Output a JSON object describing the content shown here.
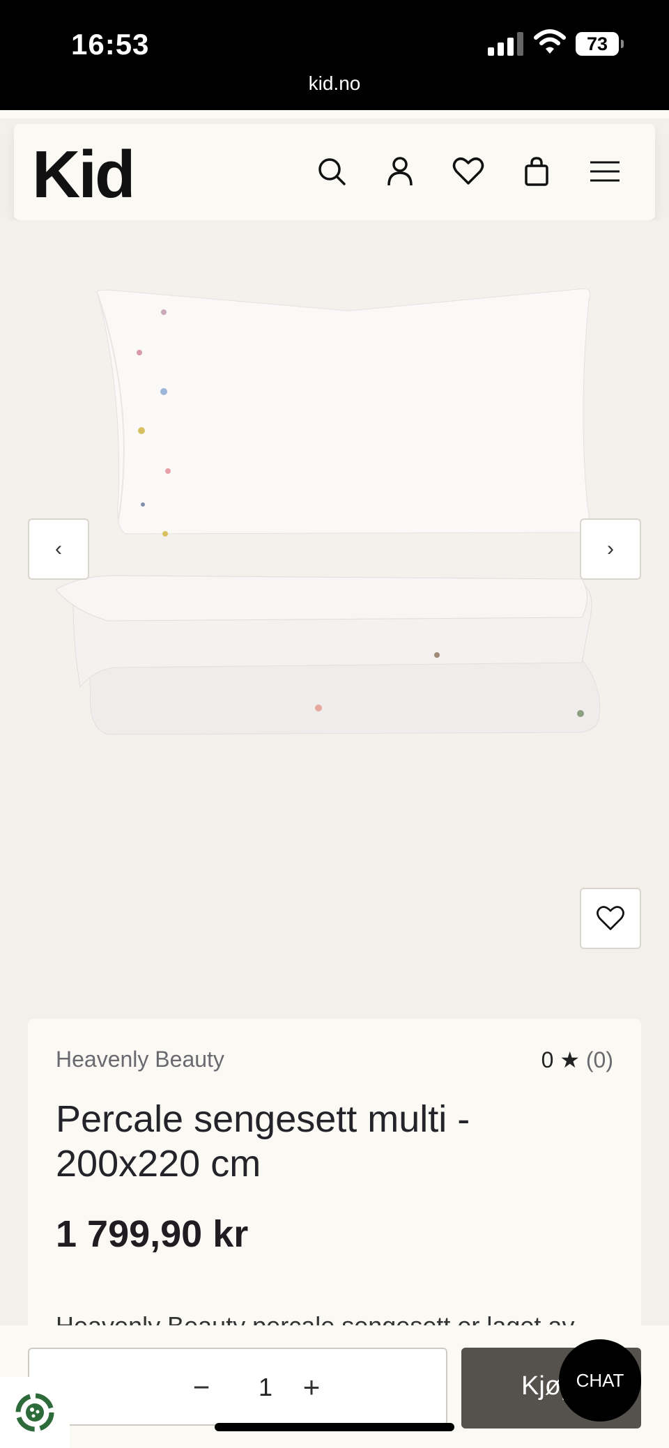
{
  "status_bar": {
    "time": "16:53",
    "url": "kid.no",
    "battery": "73"
  },
  "header": {
    "logo": "Kid",
    "icons": [
      "search-icon",
      "user-icon",
      "heart-icon",
      "bag-icon",
      "menu-icon"
    ]
  },
  "gallery": {
    "prev_label": "‹",
    "next_label": "›"
  },
  "product": {
    "brand": "Heavenly Beauty",
    "rating_value": "0",
    "rating_star": "★",
    "rating_count": "(0)",
    "title": "Percale sengesett multi - 200x220 cm",
    "price": "1 799,90 kr",
    "description": "Heavenly Beauty percale sengesett er laget av"
  },
  "cart": {
    "minus": "−",
    "quantity": "1",
    "plus": "+",
    "buy_label": "Kjøp"
  },
  "chat": {
    "label": "CHAT"
  },
  "colors": {
    "background": "#f3f0ea",
    "card": "#fbf9f4",
    "buy_button": "#55514d",
    "chat": "#000000"
  }
}
